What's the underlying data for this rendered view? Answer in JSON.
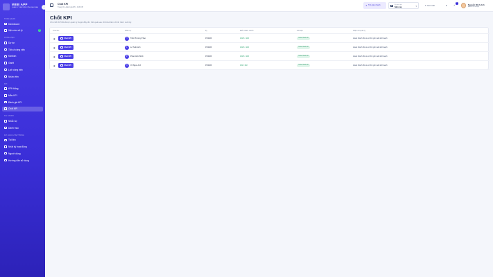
{
  "app": {
    "name": "WEB APP",
    "subtitle": "QUẢN LÝ TẤM VIỆN\nCÔNG BÁO BAN"
  },
  "sidebar": {
    "sections": [
      {
        "title": "TỔNG QUAN",
        "items": [
          {
            "label": "Dashboard",
            "icon": "dashboard-icon"
          },
          {
            "label": "Việc cần xử lý",
            "icon": "checklist-icon",
            "badge": "3"
          }
        ]
      },
      {
        "title": "CÔNG VIỆC",
        "items": [
          {
            "label": "Dự án",
            "icon": "folder-icon"
          },
          {
            "label": "Tất cả công việc",
            "icon": "tasks-icon"
          },
          {
            "label": "Kanban",
            "icon": "kanban-icon"
          },
          {
            "label": "Gantt",
            "icon": "gantt-icon"
          },
          {
            "label": "Lịch công việc",
            "icon": "calendar-icon"
          },
          {
            "label": "Nhân viên",
            "icon": "users-icon"
          }
        ]
      },
      {
        "title": "KPI",
        "items": [
          {
            "label": "KPI thắng",
            "icon": "target-icon"
          },
          {
            "label": "Mẫu KPI",
            "icon": "template-icon"
          },
          {
            "label": "Đánh giá KPI",
            "icon": "rating-icon"
          },
          {
            "label": "Chốt KPI",
            "icon": "lock-icon",
            "active": true
          }
        ]
      },
      {
        "title": "TÀI CHÍNH",
        "items": [
          {
            "label": "Nhắc nợ",
            "icon": "reminder-icon"
          },
          {
            "label": "Danh mục",
            "icon": "list-icon"
          }
        ]
      },
      {
        "title": "DỮ LIỆU & HỆ THỐNG",
        "items": [
          {
            "label": "Tài liệu",
            "icon": "document-icon"
          },
          {
            "label": "Nhật ký hoạt động",
            "icon": "activity-icon"
          },
          {
            "label": "Người dùng",
            "icon": "user-icon"
          },
          {
            "label": "Hướng dẫn sử dụng",
            "icon": "help-book-icon"
          }
        ]
      }
    ]
  },
  "header": {
    "title": "Chốt KPI",
    "subtitle": "Trang chủ › Đánh giá KPI › Chốt KPI",
    "help_label": "Trợ giúp nhanh",
    "period_label": "Kỳ đánh giá",
    "period_value": "Năm nay",
    "refresh_label": "Làm mới",
    "notification_count": "4",
    "user_name": "Nguyễn Minh Anh",
    "user_role": "Admin hệ thống ▾"
  },
  "page": {
    "title": "Chốt KPI",
    "description": "Chỉ chốt KPI đã được quản lý duyệt đầy đủ. Kết quả sau chốt là điểm chính thức cuối kỳ."
  },
  "table": {
    "columns": [
      "Thao tác",
      "Nhân sự",
      "Kỳ",
      "Điểm thành chuẩn",
      "Kết luận",
      "Nhận xét quản lý"
    ],
    "action_label": "Chốt KPI",
    "rows": [
      {
        "initials": "T",
        "name": "Trần Phương Thảo",
        "period": "07/2026",
        "score": "102.6 / 102",
        "status": "Hoàn thành tốt",
        "comment": "Hoàn thành tốt và có thể gửi xuất kế hoạch"
      },
      {
        "initials": "L",
        "name": "Lê Tuấn Anh",
        "period": "07/2026",
        "score": "102.6 / 102",
        "status": "Hoàn thành tốt",
        "comment": "Hoàn thành tốt và có thể gửi xuất kế hoạch"
      },
      {
        "initials": "P",
        "name": "Phạm Đức Minh",
        "period": "07/2026",
        "score": "102.6 / 102",
        "status": "Hoàn thành tốt",
        "comment": "Hoàn thành tốt và có thể gửi xuất kế hoạch"
      },
      {
        "initials": "V",
        "name": "Võ Ngọc Anh",
        "period": "07/2026",
        "score": "102 / 102",
        "status": "Hoàn thành tốt",
        "comment": "Hoàn thành tốt và có thể gửi xuất kế hoạch"
      }
    ]
  },
  "colors": {
    "accent": "#4a3ee6",
    "success": "#22a06b",
    "background": "#f4f6fb"
  }
}
